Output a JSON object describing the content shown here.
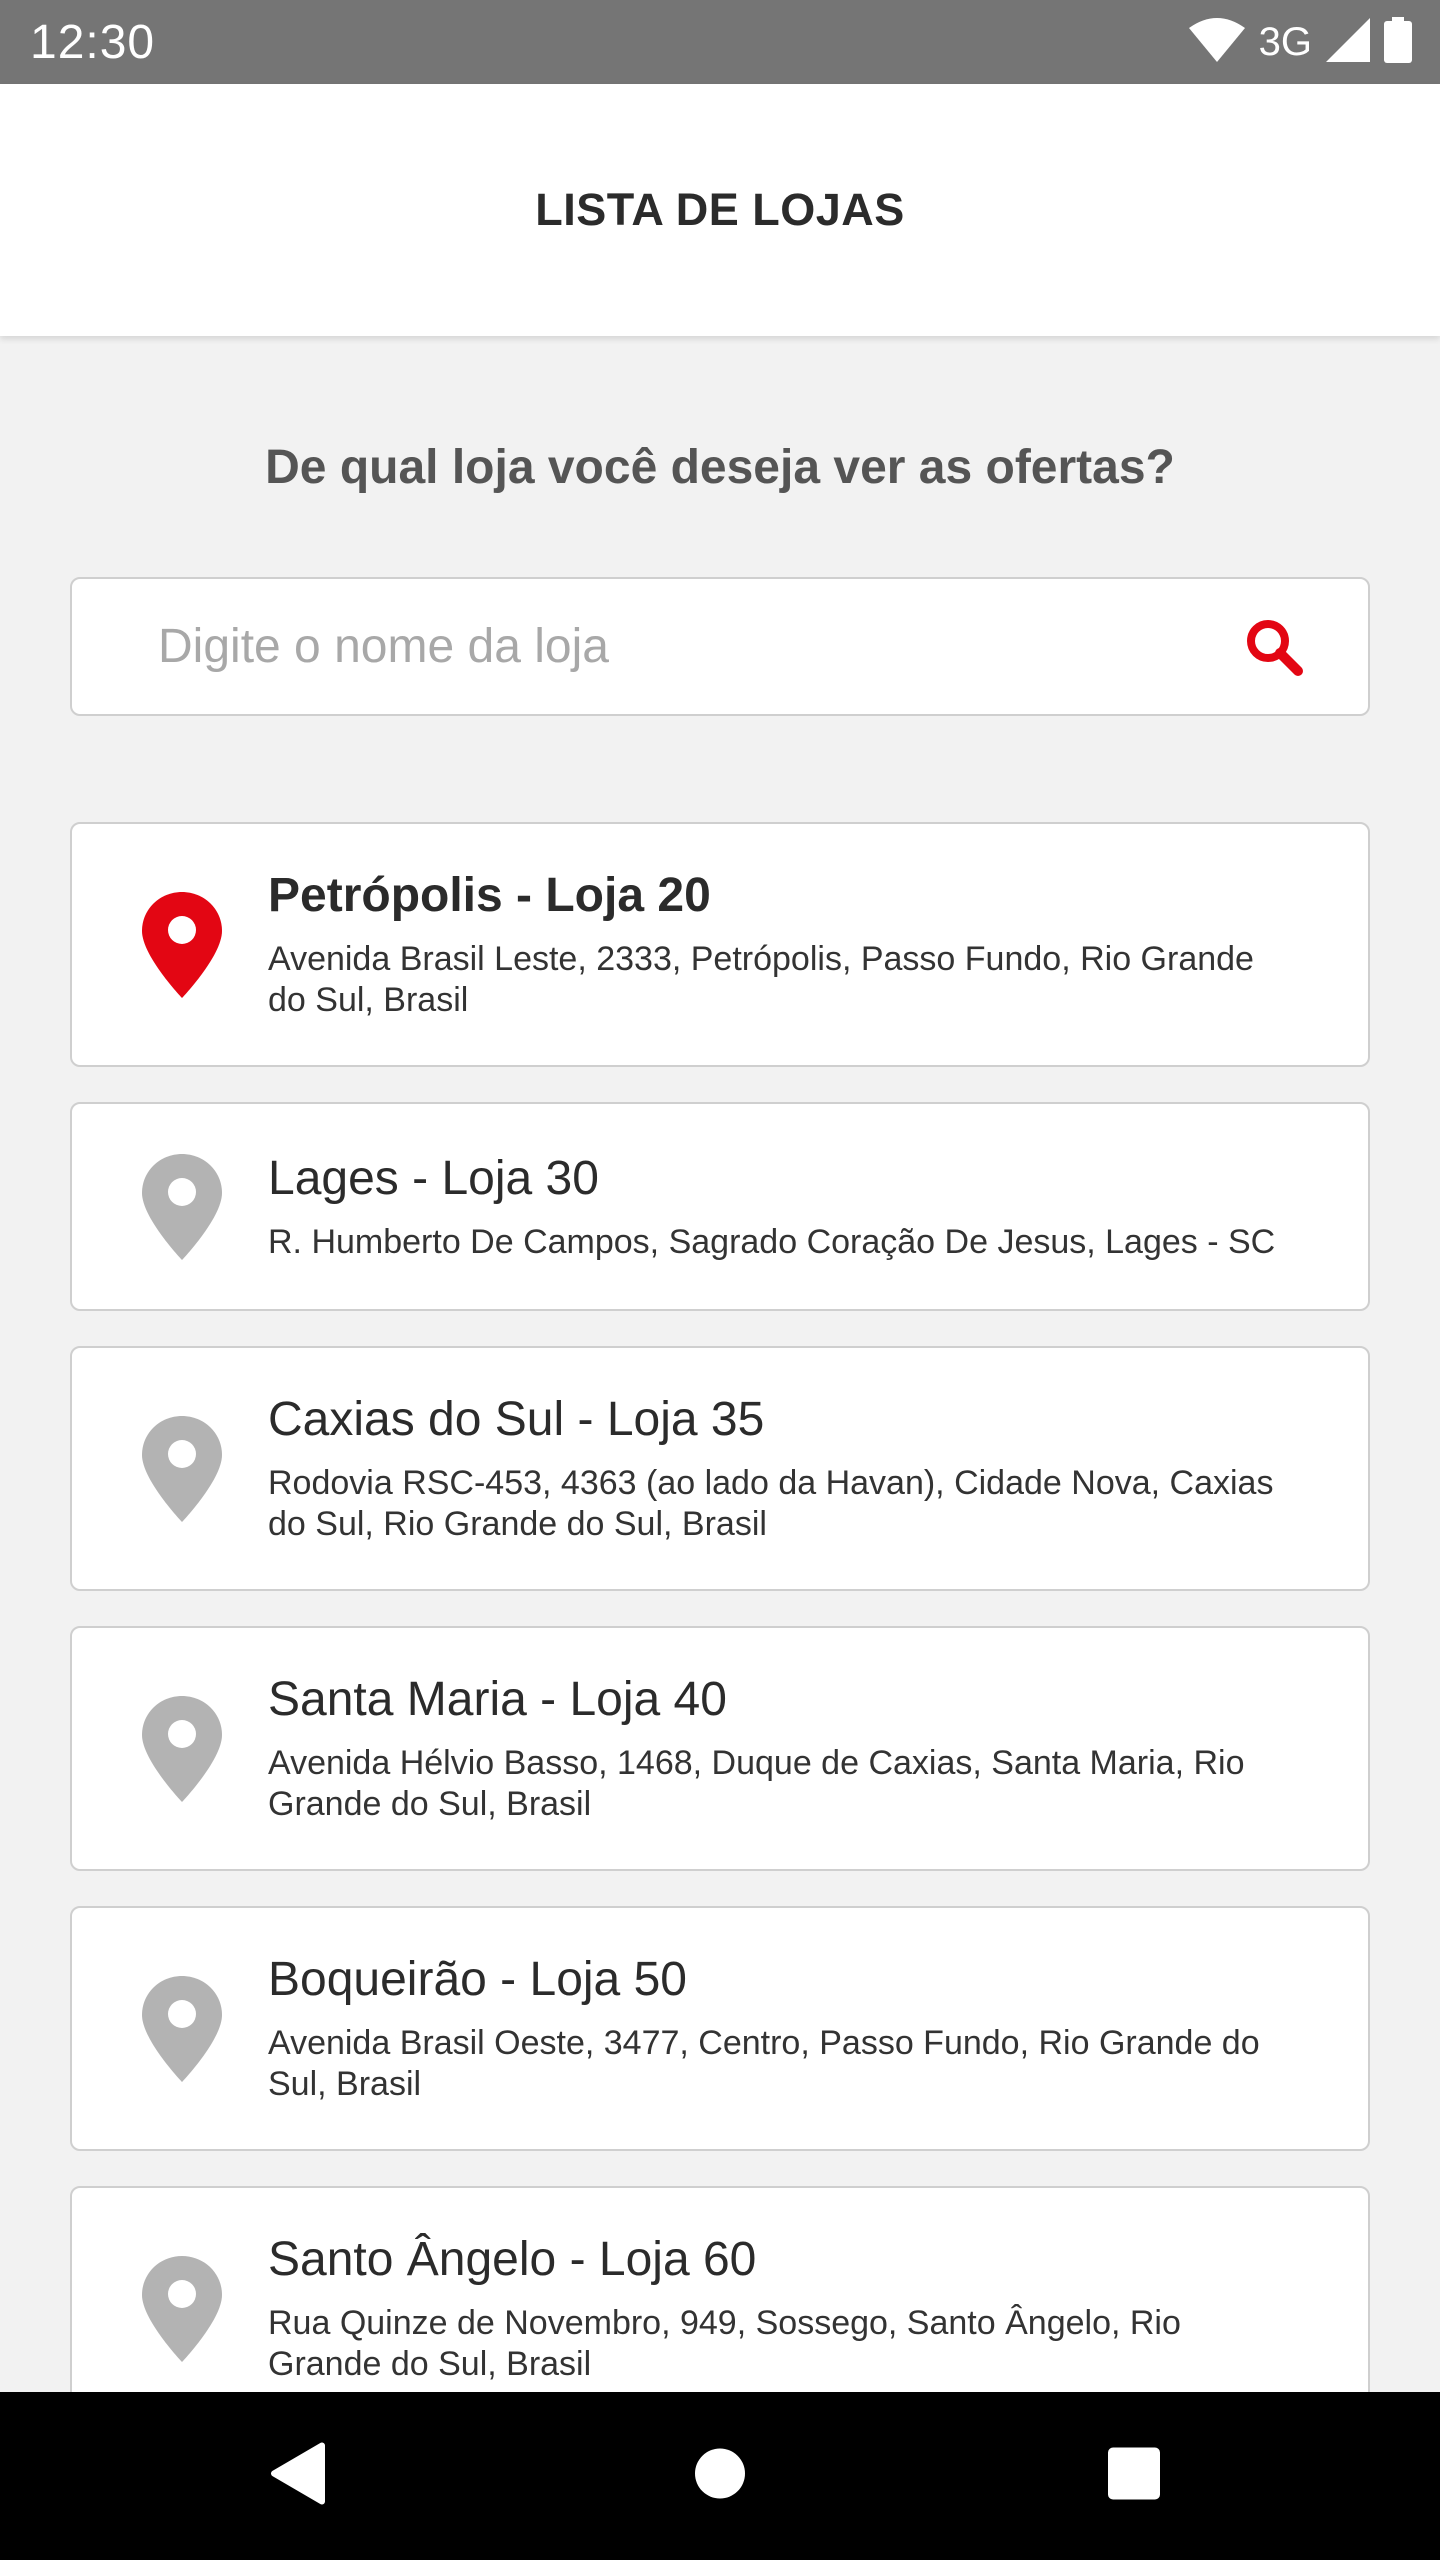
{
  "status_bar": {
    "time": "12:30",
    "network": "3G"
  },
  "header": {
    "title": "LISTA DE LOJAS"
  },
  "prompt": {
    "question": "De qual loja você deseja ver as ofertas?"
  },
  "search": {
    "placeholder": "Digite o nome da loja",
    "value": ""
  },
  "colors": {
    "accent": "#e30613",
    "pin_inactive": "#b3b3b3"
  },
  "stores": [
    {
      "name": "Petrópolis - Loja 20",
      "address": "Avenida Brasil Leste, 2333, Petrópolis, Passo Fundo, Rio Grande do Sul, Brasil",
      "selected": true
    },
    {
      "name": "Lages - Loja 30",
      "address": "R. Humberto De Campos, Sagrado Coração De Jesus, Lages - SC",
      "selected": false
    },
    {
      "name": "Caxias do Sul - Loja 35",
      "address": "Rodovia RSC-453, 4363 (ao lado da Havan), Cidade Nova, Caxias do Sul, Rio Grande do Sul, Brasil",
      "selected": false
    },
    {
      "name": "Santa Maria - Loja 40",
      "address": "Avenida Hélvio Basso, 1468, Duque de Caxias, Santa Maria, Rio Grande do Sul, Brasil",
      "selected": false
    },
    {
      "name": "Boqueirão - Loja 50",
      "address": "Avenida Brasil Oeste, 3477, Centro, Passo Fundo, Rio Grande do Sul, Brasil",
      "selected": false
    },
    {
      "name": "Santo Ângelo - Loja 60",
      "address": "Rua Quinze de Novembro, 949, Sossego, Santo Ângelo, Rio Grande do Sul, Brasil",
      "selected": false
    }
  ]
}
